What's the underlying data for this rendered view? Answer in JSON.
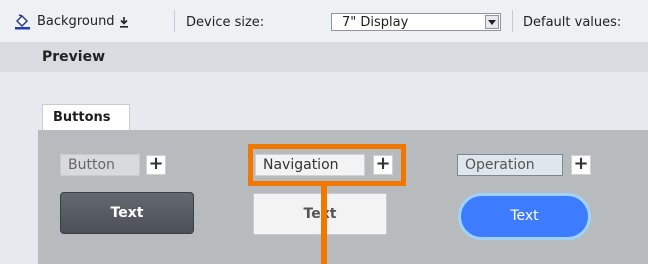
{
  "toolbar": {
    "background_label": "Background",
    "device_size_label": "Device size:",
    "device_size_value": "7\" Display",
    "default_values_label": "Default values:"
  },
  "preview": {
    "title": "Preview",
    "tab_label": "Buttons"
  },
  "styles": [
    {
      "label": "Button",
      "sample_text": "Text"
    },
    {
      "label": "Navigation",
      "sample_text": "Text"
    },
    {
      "label": "Operation",
      "sample_text": "Text"
    }
  ],
  "add_symbol": "+",
  "colors": {
    "highlight": "#f07800",
    "operation_button": "#3d7bff",
    "button_dark": "#50555b"
  },
  "icons": [
    "paint-bucket-icon",
    "download-icon",
    "dropdown-arrow-icon",
    "plus-icon"
  ]
}
